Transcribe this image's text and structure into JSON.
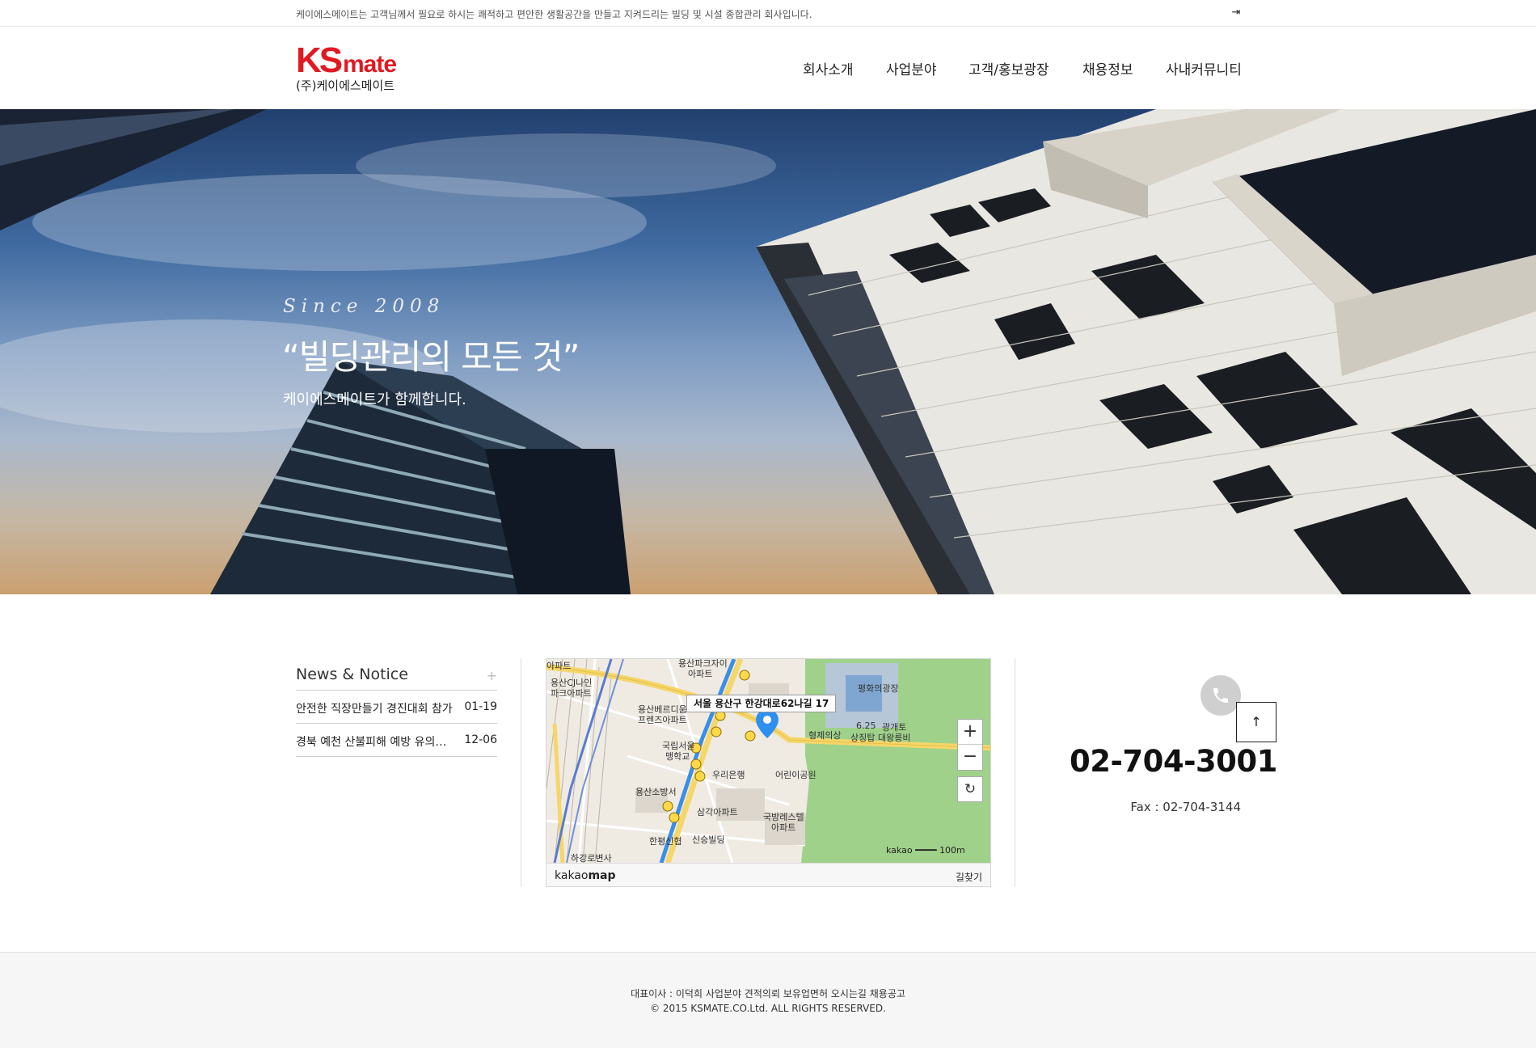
{
  "topbar": {
    "message": "케이에스메이트는 고객님께서 필요로 하시는 쾌적하고 편안한 생활공간을 만들고 지켜드리는 빌딩 및 시설 종합관리 회사입니다.",
    "login_icon": "sign-in-icon"
  },
  "logo": {
    "ks": "KS",
    "mate": "mate",
    "subtitle": "(주)케이에스메이트"
  },
  "nav": [
    "회사소개",
    "사업분야",
    "고객/홍보광장",
    "채용정보",
    "사내커뮤니티"
  ],
  "hero": {
    "since": "Since 2008",
    "headline": "“빌딩관리의 모든 것”",
    "subline": "케이에스메이트가 함께합니다."
  },
  "news": {
    "title": "News & Notice",
    "more": "+",
    "items": [
      {
        "title": "안전한 직장만들기 경진대회 참가",
        "date": "01-19"
      },
      {
        "title": "경북 예천 산불피해 예방 유의사항",
        "date": "12-06"
      }
    ]
  },
  "map": {
    "address": "서울 용산구 한강대로62나길 17",
    "labels": [
      "아파트",
      "용산파크자이",
      "아파트",
      "평화의광장",
      "용산CJ나인",
      "파크아파트",
      "용산베르디움",
      "프렌즈아파트",
      "국립서울",
      "맹학교",
      "형제의상",
      "6.25",
      "상징탑",
      "광개토",
      "대왕릉비",
      "우리은행",
      "어린이공원",
      "용산소방서",
      "삼각아파트",
      "국방레스텔",
      "아파트",
      "한평신협",
      "신승빌딩",
      "하강로변사"
    ],
    "zoom_in": "+",
    "zoom_out": "−",
    "reload": "↻",
    "scale_brand": "kakao",
    "scale": "100m",
    "brand_light": "kakao",
    "brand_bold": "map",
    "route": "길찾기"
  },
  "contact": {
    "phone_icon": "phone-icon",
    "tel": "02-704-3001",
    "fax": "Fax : 02-704-3144",
    "top_icon": "arrow-up-icon"
  },
  "footer": {
    "line1": "대표이사 : 이덕희 사업분야 견적의뢰 보유업면허 오시는길 채용공고",
    "line2": "© 2015 KSMATE.CO.Ltd. ALL RIGHTS RESERVED."
  }
}
